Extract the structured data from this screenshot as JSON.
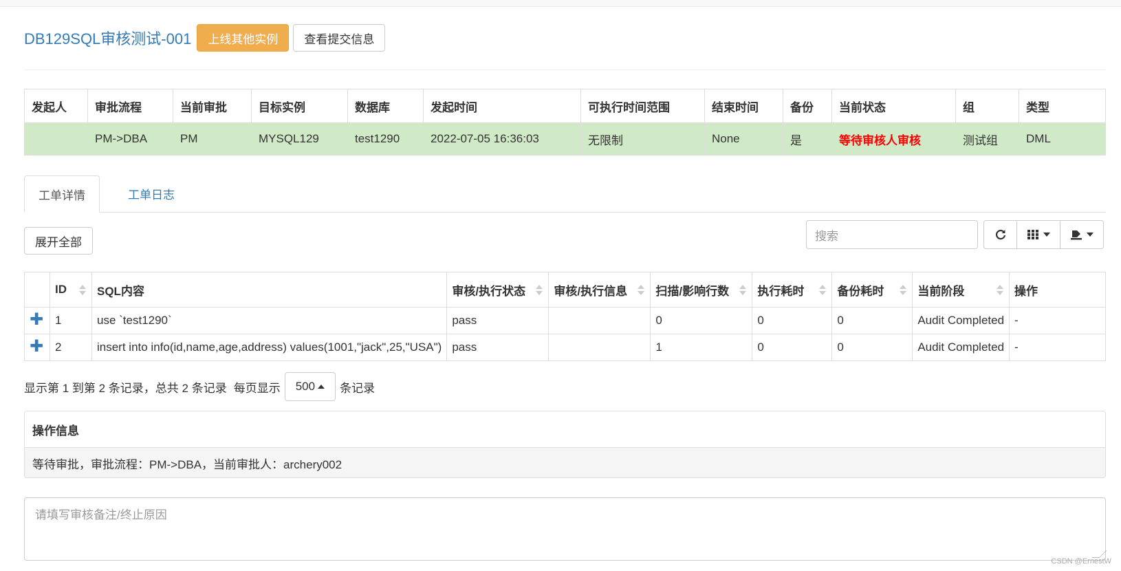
{
  "header": {
    "title": "DB129SQL审核测试-001",
    "btn_online_other": "上线其他实例",
    "btn_view_submit": "查看提交信息"
  },
  "info_table": {
    "columns": [
      "发起人",
      "审批流程",
      "当前审批",
      "目标实例",
      "数据库",
      "发起时间",
      "可执行时间范围",
      "结束时间",
      "备份",
      "当前状态",
      "组",
      "类型"
    ],
    "row": [
      "",
      "PM->DBA",
      "PM",
      "MYSQL129",
      "test1290",
      "2022-07-05 16:36:03",
      "无限制",
      "None",
      "是",
      "等待审核人审核",
      "测试组",
      "DML"
    ]
  },
  "tabs": [
    {
      "label": "工单详情",
      "active": true
    },
    {
      "label": "工单日志",
      "active": false
    }
  ],
  "toolbar": {
    "expand_all": "展开全部",
    "search_placeholder": "搜索",
    "refresh_icon": "refresh-icon",
    "columns_icon": "grid-icon",
    "export_icon": "export-icon"
  },
  "data_table": {
    "columns": [
      "ID",
      "SQL内容",
      "审核/执行状态",
      "审核/执行信息",
      "扫描/影响行数",
      "执行耗时",
      "备份耗时",
      "当前阶段",
      "操作"
    ],
    "rows": [
      {
        "id": "1",
        "sql": "use `test1290`",
        "status": "pass",
        "info": "",
        "rows": "0",
        "exec_time": "0",
        "backup_time": "0",
        "stage": "Audit Completed",
        "op": "-"
      },
      {
        "id": "2",
        "sql": "insert into info(id,name,age,address) values(1001,\"jack\",25,\"USA\")",
        "status": "pass",
        "info": "",
        "rows": "1",
        "exec_time": "0",
        "backup_time": "0",
        "stage": "Audit Completed",
        "op": "-"
      }
    ]
  },
  "pager": {
    "summary": "显示第 1 到第 2 条记录，总共 2 条记录",
    "per_page_label": "每页显示",
    "page_size": "500",
    "records_label": "条记录"
  },
  "op_panel": {
    "title": "操作信息",
    "body": "等待审批，审批流程：PM->DBA，当前审批人：archery002"
  },
  "remark": {
    "placeholder": "请填写审核备注/终止原因"
  },
  "watermark": "CSDN @ErnestW",
  "colors": {
    "link": "#337ab7",
    "warning": "#f0ad4e",
    "success_row": "#d0e9c6",
    "status_red": "#ff0000"
  }
}
